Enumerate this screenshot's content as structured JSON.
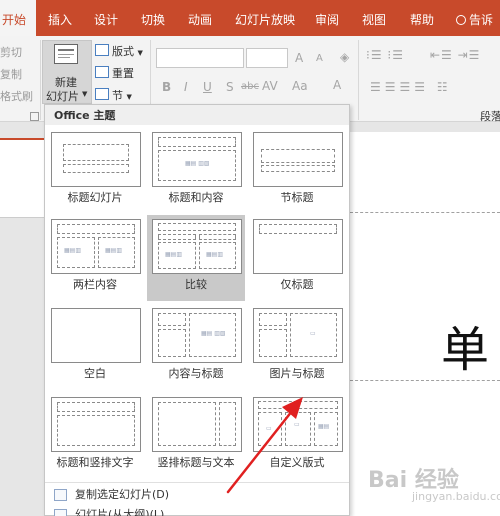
{
  "tabs": {
    "home": "开始",
    "insert": "插入",
    "design": "设计",
    "transitions": "切换",
    "animations": "动画",
    "slideshow": "幻灯片放映",
    "review": "审阅",
    "view": "视图",
    "help": "帮助",
    "tellme": "告诉"
  },
  "ribbon": {
    "cut_partial": "剪切",
    "copy_partial": "复制",
    "painter_partial": "格式刷",
    "new_slide_line1": "新建",
    "new_slide_line2": "幻灯片",
    "layout": "版式",
    "reset": "重置",
    "section": "节",
    "paragraph_partial": "段落",
    "font_glyphs": [
      "B",
      "I",
      "U",
      "S",
      "abc",
      "AV",
      "Aa",
      "A"
    ],
    "grow_shrink": [
      "A",
      "A"
    ]
  },
  "dropdown": {
    "header": "Office 主题",
    "layouts": [
      {
        "label": "标题幻灯片"
      },
      {
        "label": "标题和内容"
      },
      {
        "label": "节标题"
      },
      {
        "label": "两栏内容"
      },
      {
        "label": "比较"
      },
      {
        "label": "仅标题"
      },
      {
        "label": "空白"
      },
      {
        "label": "内容与标题"
      },
      {
        "label": "图片与标题"
      },
      {
        "label": "标题和竖排文字"
      },
      {
        "label": "竖排标题与文本"
      },
      {
        "label": "自定义版式"
      }
    ],
    "selected_index": 4,
    "menu": [
      {
        "label": "复制选定幻灯片(D)"
      },
      {
        "label": "幻灯片(从大纲)(L)..."
      }
    ]
  },
  "slide": {
    "visible_text": "单"
  },
  "watermark": {
    "main": "Bai 经验",
    "sub": "jingyan.baidu.com"
  },
  "colors": {
    "accent": "#c84a2b",
    "ribbon_bg": "#f3f3f3",
    "selected_cell": "#c9c9c9"
  }
}
